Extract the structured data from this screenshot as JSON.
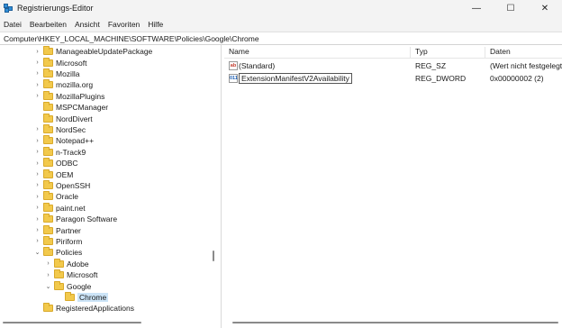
{
  "window": {
    "title": "Registrierungs-Editor",
    "minimize": "—",
    "maximize": "☐",
    "close": "✕"
  },
  "menu": [
    "Datei",
    "Bearbeiten",
    "Ansicht",
    "Favoriten",
    "Hilfe"
  ],
  "address": "Computer\\HKEY_LOCAL_MACHINE\\SOFTWARE\\Policies\\Google\\Chrome",
  "tree": [
    {
      "label": "ManageableUpdatePackage",
      "level": 1,
      "expander": "›"
    },
    {
      "label": "Microsoft",
      "level": 1,
      "expander": "›"
    },
    {
      "label": "Mozilla",
      "level": 1,
      "expander": "›"
    },
    {
      "label": "mozilla.org",
      "level": 1,
      "expander": "›"
    },
    {
      "label": "MozillaPlugins",
      "level": 1,
      "expander": "›"
    },
    {
      "label": "MSPCManager",
      "level": 1,
      "expander": ""
    },
    {
      "label": "NordDivert",
      "level": 1,
      "expander": ""
    },
    {
      "label": "NordSec",
      "level": 1,
      "expander": "›"
    },
    {
      "label": "Notepad++",
      "level": 1,
      "expander": "›"
    },
    {
      "label": "n-Track9",
      "level": 1,
      "expander": "›"
    },
    {
      "label": "ODBC",
      "level": 1,
      "expander": "›"
    },
    {
      "label": "OEM",
      "level": 1,
      "expander": "›"
    },
    {
      "label": "OpenSSH",
      "level": 1,
      "expander": "›"
    },
    {
      "label": "Oracle",
      "level": 1,
      "expander": "›"
    },
    {
      "label": "paint.net",
      "level": 1,
      "expander": "›"
    },
    {
      "label": "Paragon Software",
      "level": 1,
      "expander": "›"
    },
    {
      "label": "Partner",
      "level": 1,
      "expander": "›"
    },
    {
      "label": "Piriform",
      "level": 1,
      "expander": "›"
    },
    {
      "label": "Policies",
      "level": 1,
      "expander": "⌄"
    },
    {
      "label": "Adobe",
      "level": 2,
      "expander": "›"
    },
    {
      "label": "Microsoft",
      "level": 2,
      "expander": "›"
    },
    {
      "label": "Google",
      "level": 2,
      "expander": "⌄"
    },
    {
      "label": "Chrome",
      "level": 3,
      "expander": "",
      "selected": true
    },
    {
      "label": "RegisteredApplications",
      "level": 1,
      "expander": ""
    }
  ],
  "list": {
    "columns": [
      "Name",
      "Typ",
      "Daten"
    ],
    "rows": [
      {
        "icon": "string-value-icon",
        "glyph": "ab",
        "name": "(Standard)",
        "type": "REG_SZ",
        "data": "(Wert nicht festgelegt)"
      },
      {
        "icon": "dword-value-icon",
        "glyph": "011",
        "name": "ExtensionManifestV2Availability",
        "type": "REG_DWORD",
        "data": "0x00000002 (2)",
        "editing": true
      }
    ]
  }
}
